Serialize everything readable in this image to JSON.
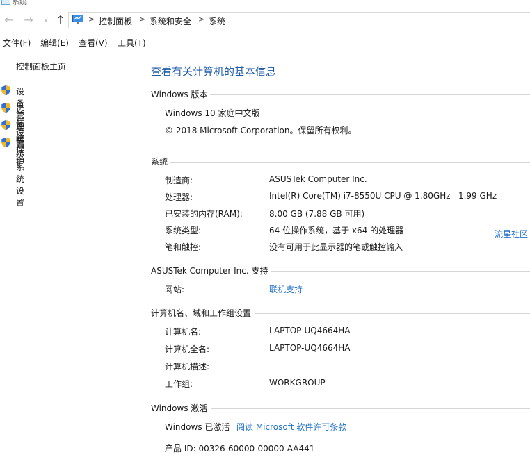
{
  "window": {
    "title": "系统"
  },
  "nav": {
    "back": "←",
    "forward": "→",
    "dropdown": "∨",
    "up": "↑",
    "separator": ">",
    "breadcrumbs": [
      "控制面板",
      "系统和安全",
      "系统"
    ]
  },
  "menu": [
    "文件(F)",
    "编辑(E)",
    "查看(V)",
    "工具(T)"
  ],
  "sidebar": {
    "home": "控制面板主页",
    "items": [
      {
        "label": "设备管理器",
        "icon": "uac-shield-icon"
      },
      {
        "label": "远程设置",
        "icon": "uac-shield-icon"
      },
      {
        "label": "系统保护",
        "icon": "uac-shield-icon"
      },
      {
        "label": "高级系统设置",
        "icon": "uac-shield-icon"
      }
    ]
  },
  "main": {
    "title": "查看有关计算机的基本信息",
    "edition": {
      "heading": "Windows 版本",
      "name": "Windows 10 家庭中文版",
      "copyright": "© 2018 Microsoft Corporation。保留所有权利。"
    },
    "system": {
      "heading": "系统",
      "rows": [
        {
          "key": "制造商:",
          "value": "ASUSTek Computer Inc."
        },
        {
          "key": "处理器:",
          "value": "Intel(R) Core(TM) i7-8550U CPU @ 1.80GHz   1.99 GHz"
        },
        {
          "key": "已安装的内存(RAM):",
          "value": "8.00 GB (7.88 GB 可用)"
        },
        {
          "key": "系统类型:",
          "value": "64 位操作系统，基于 x64 的处理器"
        },
        {
          "key": "笔和触控:",
          "value": "没有可用于此显示器的笔或触控输入"
        }
      ]
    },
    "support": {
      "heading": "ASUSTek Computer Inc. 支持",
      "website_key": "网站:",
      "website_link": "联机支持"
    },
    "computer": {
      "heading": "计算机名、域和工作组设置",
      "rows": [
        {
          "key": "计算机名:",
          "value": "LAPTOP-UQ4664HA"
        },
        {
          "key": "计算机全名:",
          "value": "LAPTOP-UQ4664HA"
        },
        {
          "key": "计算机描述:",
          "value": ""
        },
        {
          "key": "工作组:",
          "value": "WORKGROUP"
        }
      ]
    },
    "activation": {
      "heading": "Windows 激活",
      "status": "Windows 已激活",
      "license_link": "阅读 Microsoft 软件许可条款",
      "product_id": "产品 ID: 00326-60000-00000-AA441"
    },
    "watermark": "流星社区"
  },
  "colors": {
    "accent": "#1e5aa8",
    "link": "#1e6fc6",
    "shield_blue": "#2f6fd6",
    "shield_gold": "#f2b822"
  }
}
